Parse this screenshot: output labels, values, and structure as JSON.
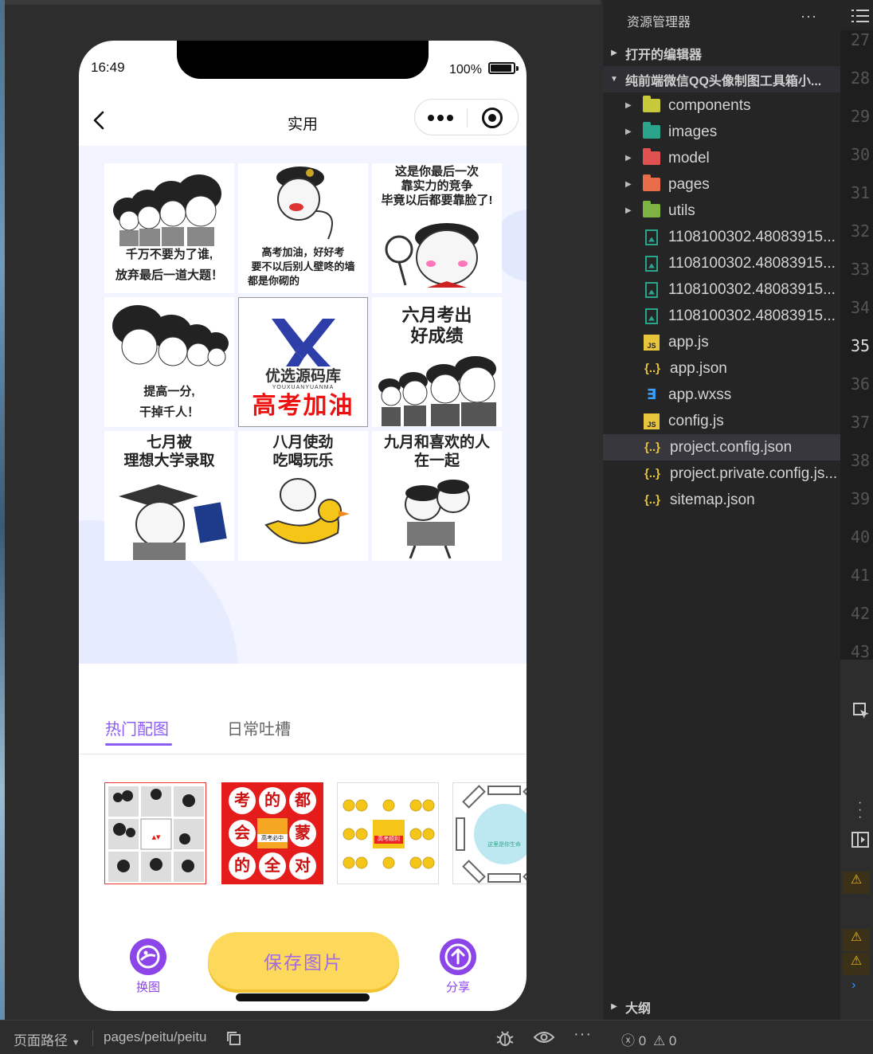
{
  "phone": {
    "status_time": "16:49",
    "battery": "100%",
    "nav_title": "实用",
    "grid": {
      "c1": [
        "千万不要为了谁,",
        "放弃最后一道大题！"
      ],
      "c2": [
        "高考加油，好好考",
        "要不以后别人壁咚的墙",
        "都是你砌的"
      ],
      "c3": [
        "这是你最后一次",
        "靠实力的竞争",
        "毕竟以后都要靠脸了!"
      ],
      "c4": [
        "提高一分,",
        "干掉千人！"
      ],
      "c5_logo": "优选源码库",
      "c5_sub": "YOUXUANYUANMA",
      "c5_red": "高考加油",
      "c6": [
        "六月考出",
        "好成绩"
      ],
      "c7": [
        "七月被",
        "理想大学录取"
      ],
      "c8": [
        "八月使劲",
        "吃喝玩乐"
      ],
      "c9": [
        "九月和喜欢的人",
        "在一起"
      ]
    },
    "tabs": {
      "active": "热门配图",
      "inactive": "日常吐槽"
    },
    "thumb2_chars": [
      "考",
      "的",
      "都",
      "会",
      "蒙",
      "的",
      "全",
      "对"
    ],
    "thumb2_center": "高考必中",
    "thumb3_center": "高考顺利",
    "thumb4_center": "这里是你生命",
    "actions": {
      "swap": "换图",
      "save": "保存图片",
      "share": "分享"
    }
  },
  "explorer": {
    "title": "资源管理器",
    "more": "···",
    "open_editors": "打开的编辑器",
    "project": "纯前端微信QQ头像制图工具箱小...",
    "items": [
      {
        "name": "components",
        "type": "folder",
        "color": "#c7c93a"
      },
      {
        "name": "images",
        "type": "folder",
        "color": "#2aa58c"
      },
      {
        "name": "model",
        "type": "folder",
        "color": "#e05252"
      },
      {
        "name": "pages",
        "type": "folder",
        "color": "#e86b4a"
      },
      {
        "name": "utils",
        "type": "folder",
        "color": "#7cb342"
      },
      {
        "name": "1108100302.48083915...",
        "type": "image"
      },
      {
        "name": "1108100302.48083915...",
        "type": "image"
      },
      {
        "name": "1108100302.48083915...",
        "type": "image"
      },
      {
        "name": "1108100302.48083915...",
        "type": "image"
      },
      {
        "name": "app.js",
        "type": "js"
      },
      {
        "name": "app.json",
        "type": "json"
      },
      {
        "name": "app.wxss",
        "type": "css"
      },
      {
        "name": "config.js",
        "type": "js"
      },
      {
        "name": "project.config.json",
        "type": "json",
        "selected": true
      },
      {
        "name": "project.private.config.js...",
        "type": "json"
      },
      {
        "name": "sitemap.json",
        "type": "json"
      }
    ],
    "outline": "大纲",
    "js_badge": "JS",
    "json_badge": "{..}",
    "css_badge": "∃"
  },
  "gutter_lines": [
    "27",
    "28",
    "29",
    "30",
    "31",
    "32",
    "33",
    "34",
    "35",
    "36",
    "37",
    "38",
    "39",
    "40",
    "41",
    "42",
    "43"
  ],
  "current_line": "35",
  "statusbar": {
    "path_label": "页面路径",
    "path": "pages/peitu/peitu",
    "errors": "0",
    "warnings": "0"
  }
}
